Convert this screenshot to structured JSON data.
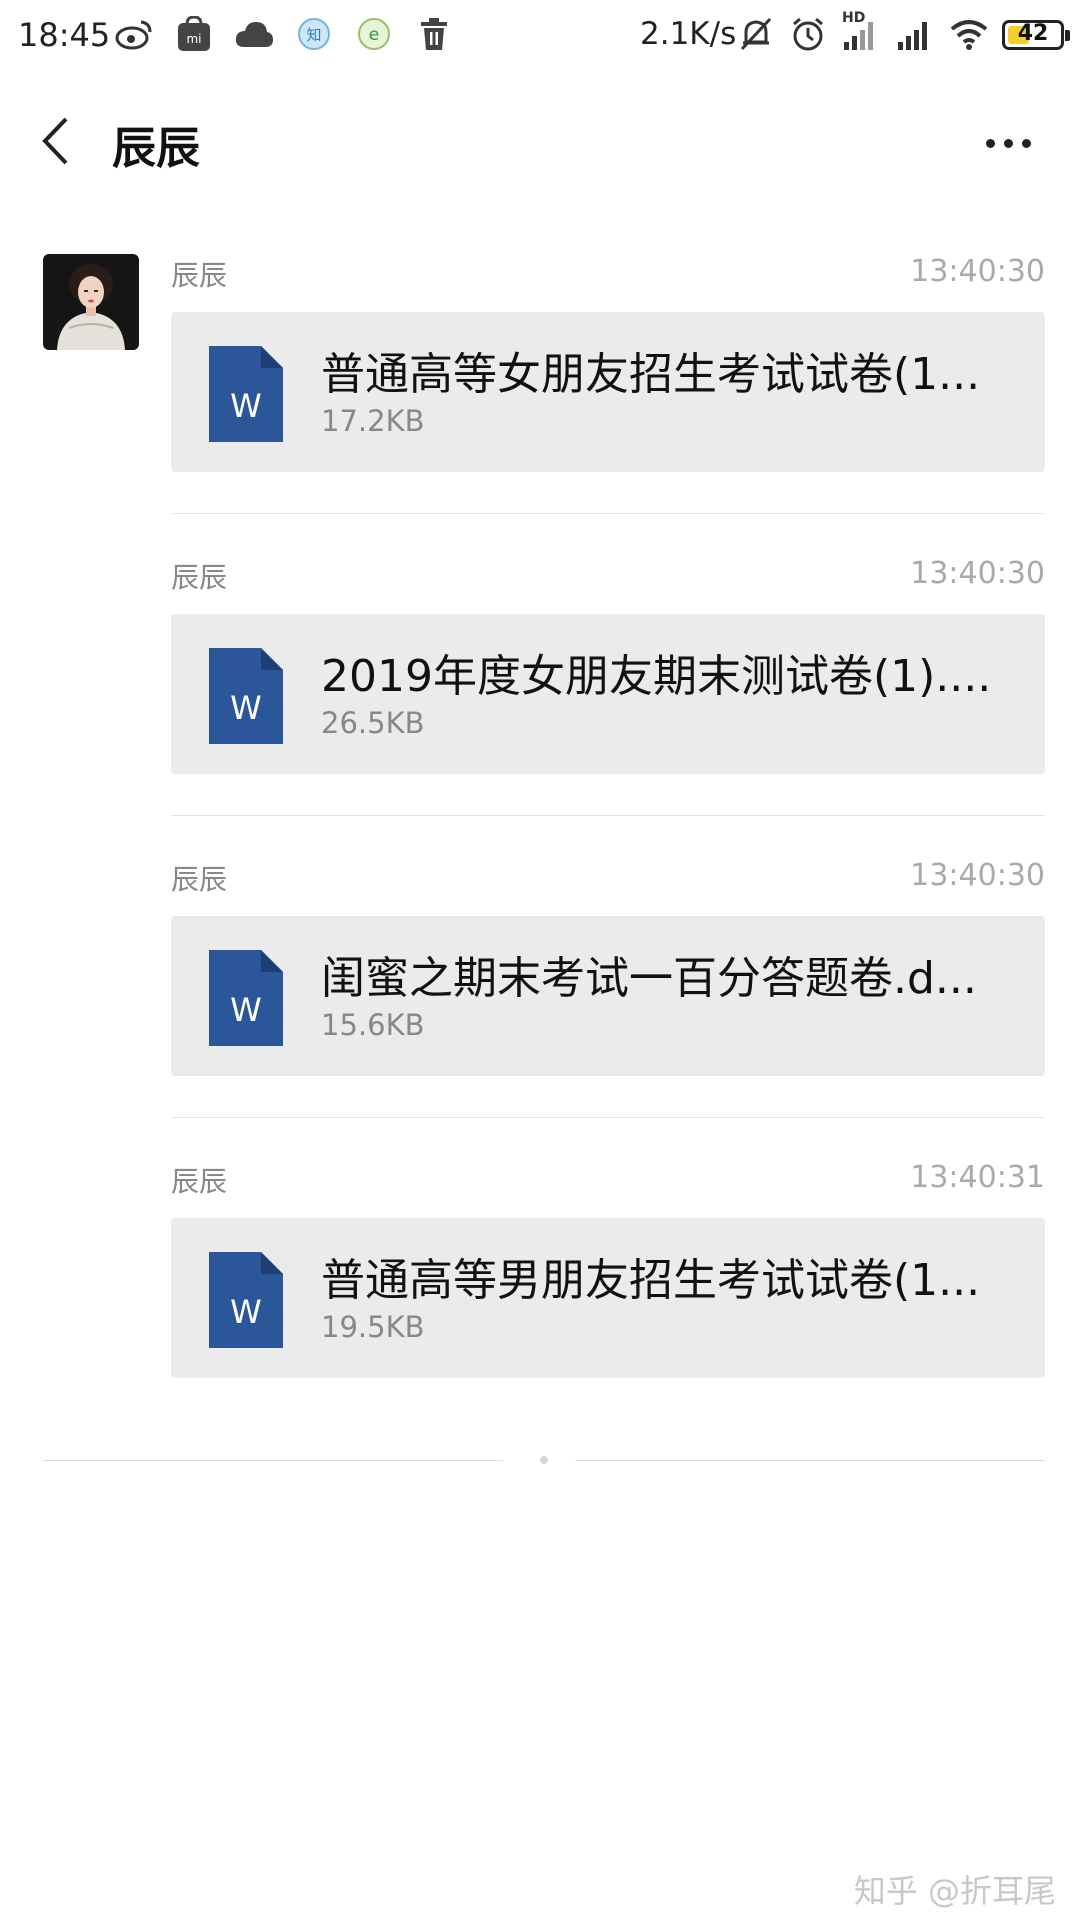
{
  "status_bar": {
    "time": "18:45",
    "net_speed": "2.1K/s",
    "hd_label": "HD",
    "battery": "42",
    "left_icons": [
      "weibo-icon",
      "mi-store-icon",
      "cloud-icon",
      "zhihu-app-icon",
      "browser-icon",
      "trash-icon"
    ],
    "right_icons": [
      "mute-bell-icon",
      "alarm-icon",
      "signal-hd-icon",
      "signal-icon",
      "wifi-icon",
      "battery-icon"
    ]
  },
  "header": {
    "title": "辰辰",
    "back_icon": "chevron-left-icon",
    "more_icon": "more-dots-icon"
  },
  "messages": [
    {
      "sender": "辰辰",
      "time": "13:40:30",
      "file_name": "普通高等女朋友招生考试试卷(1...",
      "file_size": "17.2KB",
      "icon": "word-file-icon",
      "icon_letter": "W"
    },
    {
      "sender": "辰辰",
      "time": "13:40:30",
      "file_name": "2019年度女朋友期末测试卷(1)....",
      "file_size": "26.5KB",
      "icon": "word-file-icon",
      "icon_letter": "W"
    },
    {
      "sender": "辰辰",
      "time": "13:40:30",
      "file_name": "闺蜜之期末考试一百分答题卷.d...",
      "file_size": "15.6KB",
      "icon": "word-file-icon",
      "icon_letter": "W"
    },
    {
      "sender": "辰辰",
      "time": "13:40:31",
      "file_name": "普通高等男朋友招生考试试卷(1...",
      "file_size": "19.5KB",
      "icon": "word-file-icon",
      "icon_letter": "W"
    }
  ],
  "watermark": "知乎 @折耳尾",
  "colors": {
    "word_blue": "#2b579a",
    "card_bg": "#ebebeb",
    "battery_fill": "#f4d02a"
  }
}
